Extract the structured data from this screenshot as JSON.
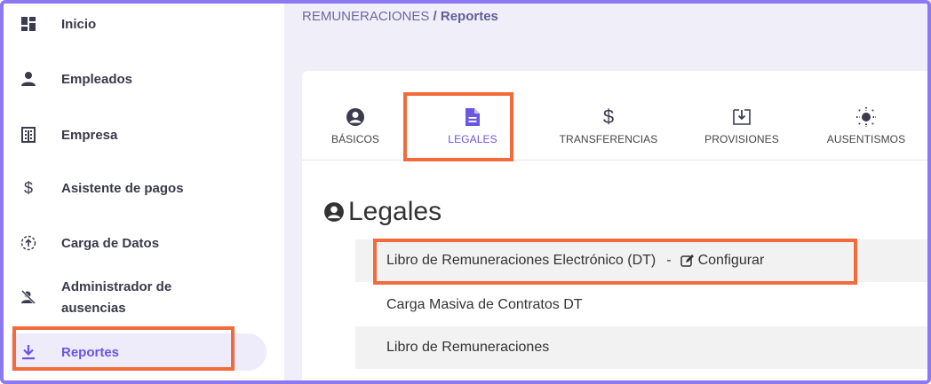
{
  "sidebar": {
    "items": [
      {
        "label": "Inicio",
        "icon": "dashboard-icon"
      },
      {
        "label": "Empleados",
        "icon": "person-icon"
      },
      {
        "label": "Empresa",
        "icon": "building-icon"
      },
      {
        "label": "Asistente de pagos",
        "icon": "dollar-icon"
      },
      {
        "label": "Carga de Datos",
        "icon": "upload-circle-icon"
      },
      {
        "label": "Administrador de",
        "label2": "ausencias",
        "icon": "person-off-icon"
      },
      {
        "label": "Reportes",
        "icon": "download-icon",
        "active": true
      }
    ]
  },
  "breadcrumb": {
    "parent": "REMUNERACIONES",
    "separator": "/",
    "current": "Reportes"
  },
  "tabs": [
    {
      "label": "BÁSICOS",
      "icon": "user-circle-icon"
    },
    {
      "label": "LEGALES",
      "icon": "document-icon",
      "active": true
    },
    {
      "label": "TRANSFERENCIAS",
      "icon": "dollar-icon"
    },
    {
      "label": "PROVISIONES",
      "icon": "tray-download-icon"
    },
    {
      "label": "AUSENTISMOS",
      "icon": "sun-icon"
    }
  ],
  "section": {
    "title": "Legales",
    "icon": "user-circle-icon"
  },
  "reports": [
    {
      "label": "Libro de Remuneraciones Electrónico (DT)",
      "separator": "-",
      "action": "Configurar"
    },
    {
      "label": "Carga Masiva de Contratos DT"
    },
    {
      "label": "Libro de Remuneraciones"
    }
  ],
  "colors": {
    "accent": "#6a56e0",
    "highlight": "#f26b3a",
    "frame": "#8b78f2",
    "main_bg": "#f0eef9"
  }
}
